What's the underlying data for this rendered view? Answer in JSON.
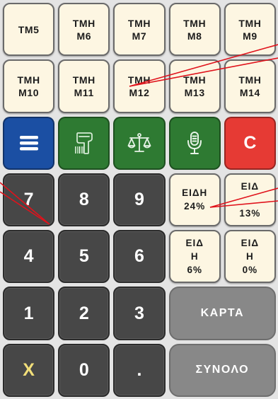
{
  "colors": {
    "background": "#e4e4e4",
    "department_key": "#fdf6e2",
    "number_key": "#474747",
    "menu_key": "#1b4fa3",
    "tool_key": "#2e7a32",
    "clear_key": "#e63a34",
    "action_key": "#888888",
    "multiply_text": "#f2df7a",
    "annotation": "#e0121b"
  },
  "department_keys": [
    {
      "lines": [
        "ΤΜ5"
      ]
    },
    {
      "lines": [
        "ΤΜΗ",
        "Μ6"
      ]
    },
    {
      "lines": [
        "ΤΜΗ",
        "Μ7"
      ]
    },
    {
      "lines": [
        "ΤΜΗ",
        "Μ8"
      ]
    },
    {
      "lines": [
        "ΤΜΗ",
        "Μ9"
      ]
    },
    {
      "lines": [
        "ΤΜΗ",
        "Μ10"
      ]
    },
    {
      "lines": [
        "ΤΜΗ",
        "Μ11"
      ]
    },
    {
      "lines": [
        "ΤΜΗ",
        "Μ12"
      ]
    },
    {
      "lines": [
        "ΤΜΗ",
        "Μ13"
      ]
    },
    {
      "lines": [
        "ΤΜΗ",
        "Μ14"
      ]
    }
  ],
  "function_keys": {
    "menu": {
      "icon": "menu-icon"
    },
    "barcode": {
      "icon": "barcode-scanner-icon"
    },
    "scale": {
      "icon": "scale-icon"
    },
    "voice": {
      "icon": "microphone-icon"
    },
    "clear": {
      "label": "C"
    }
  },
  "vat_keys": [
    {
      "lines": [
        "ΕΙΔΗ",
        "24%"
      ]
    },
    {
      "lines": [
        "ΕΙΔ",
        "13%"
      ]
    },
    {
      "lines": [
        "ΕΙΔ",
        "Η",
        "6%"
      ]
    },
    {
      "lines": [
        "ΕΙΔ",
        "Η",
        "0%"
      ]
    }
  ],
  "numpad": {
    "keys": [
      "7",
      "8",
      "9",
      "4",
      "5",
      "6",
      "1",
      "2",
      "3",
      "X",
      "0",
      "."
    ]
  },
  "action_keys": {
    "card": "ΚΑΡΤΑ",
    "total": "ΣΥΝΟΛΟ"
  }
}
